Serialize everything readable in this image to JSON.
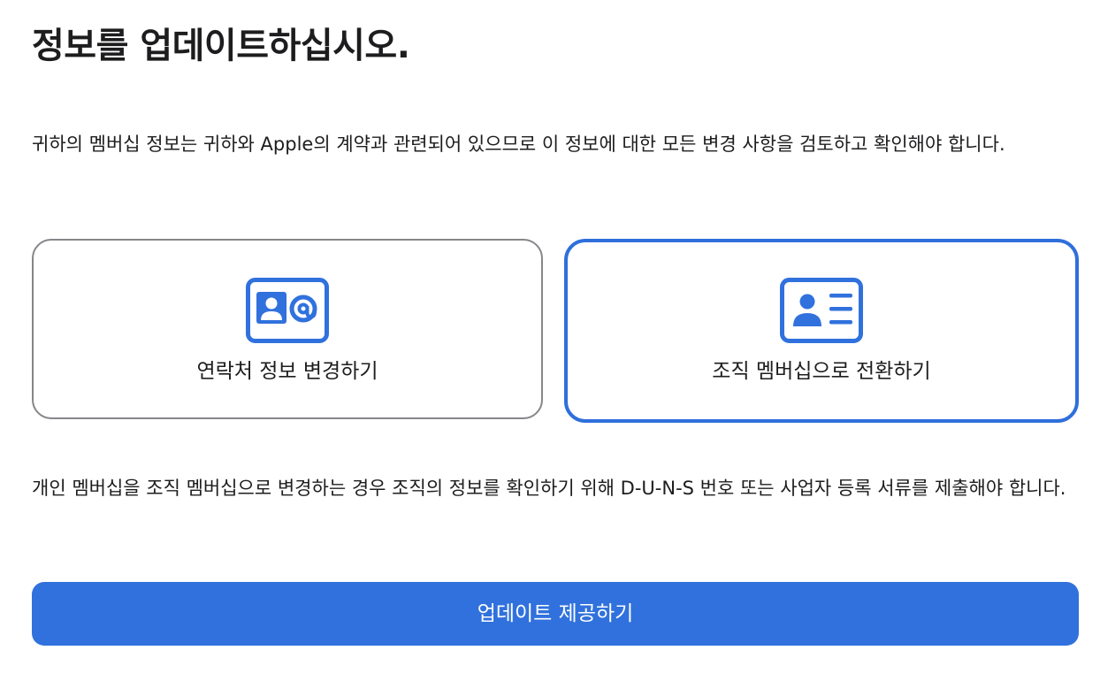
{
  "page": {
    "title": "정보를 업데이트하십시오.",
    "description": "귀하의 멤버십 정보는 귀하와 Apple의 계약과 관련되어 있으므로 이 정보에 대한 모든 변경 사항을 검토하고 확인해야 합니다.",
    "note": "개인 멤버십을 조직 멤버십으로 변경하는 경우 조직의 정보를 확인하기 위해 D-U-N-S 번호 또는 사업자 등록 서류를 제출해야 합니다."
  },
  "options": [
    {
      "label": "연락처 정보 변경하기",
      "icon": "contact-card-at-icon",
      "selected": false
    },
    {
      "label": "조직 멤버십으로 전환하기",
      "icon": "id-card-icon",
      "selected": true
    }
  ],
  "actions": {
    "submit_label": "업데이트 제공하기"
  },
  "colors": {
    "accent": "#3071dd",
    "selected_border": "#2f6fdc",
    "card_border": "#86868b",
    "text": "#1d1d1f"
  }
}
